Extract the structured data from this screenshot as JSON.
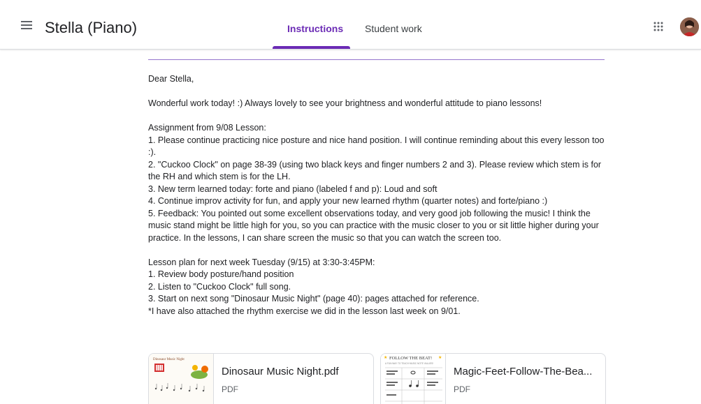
{
  "header": {
    "title": "Stella (Piano)",
    "tabs": [
      {
        "label": "Instructions",
        "active": true
      },
      {
        "label": "Student work",
        "active": false
      }
    ],
    "accent_color": "#6b2bb5",
    "icons": [
      "menu-icon",
      "apps-grid-icon",
      "avatar"
    ]
  },
  "message": {
    "greeting": "Dear Stella,",
    "intro": "Wonderful work today! :) Always lovely to see your brightness and wonderful attitude to piano lessons!",
    "assignment_heading": "Assignment from 9/08 Lesson:",
    "assignment_items": [
      "1. Please continue practicing nice posture and nice hand position. I will continue reminding about this every lesson too :).",
      "2. \"Cuckoo Clock\" on page 38-39 (using two black keys and finger numbers 2 and 3). Please review which stem is for the RH and which stem is for the LH.",
      "3. New term learned today: forte and piano (labeled f and p): Loud and soft",
      "4. Continue improv activity for fun, and apply your new learned rhythm (quarter notes) and forte/piano :)",
      "5. Feedback: You pointed out some excellent observations today, and very good job following the music! I think the music stand might be little high for you, so you can practice with the music closer to you or sit little higher during your practice. In the lessons, I can share screen the music so that you can watch the screen too."
    ],
    "plan_heading": "Lesson plan for next week Tuesday (9/15) at 3:30-3:45PM:",
    "plan_items": [
      "1. Review body posture/hand position",
      "2. Listen to \"Cuckoo Clock\" full song.",
      "3. Start on next song \"Dinosaur Music Night\" (page 40): pages attached for reference.",
      "*I have also attached the rhythm exercise we did in the lesson last week on 9/01."
    ]
  },
  "attachments": [
    {
      "title": "Dinosaur Music Night.pdf",
      "type": "PDF",
      "thumb_heading": "Dinosaur Music Night"
    },
    {
      "title": "Magic-Feet-Follow-The-Bea...",
      "type": "PDF",
      "thumb_heading": "FOLLOW THE BEAT!",
      "thumb_subheading": "A FUN WAY TO TEACH MUSIC NOTE VALUES!"
    }
  ]
}
